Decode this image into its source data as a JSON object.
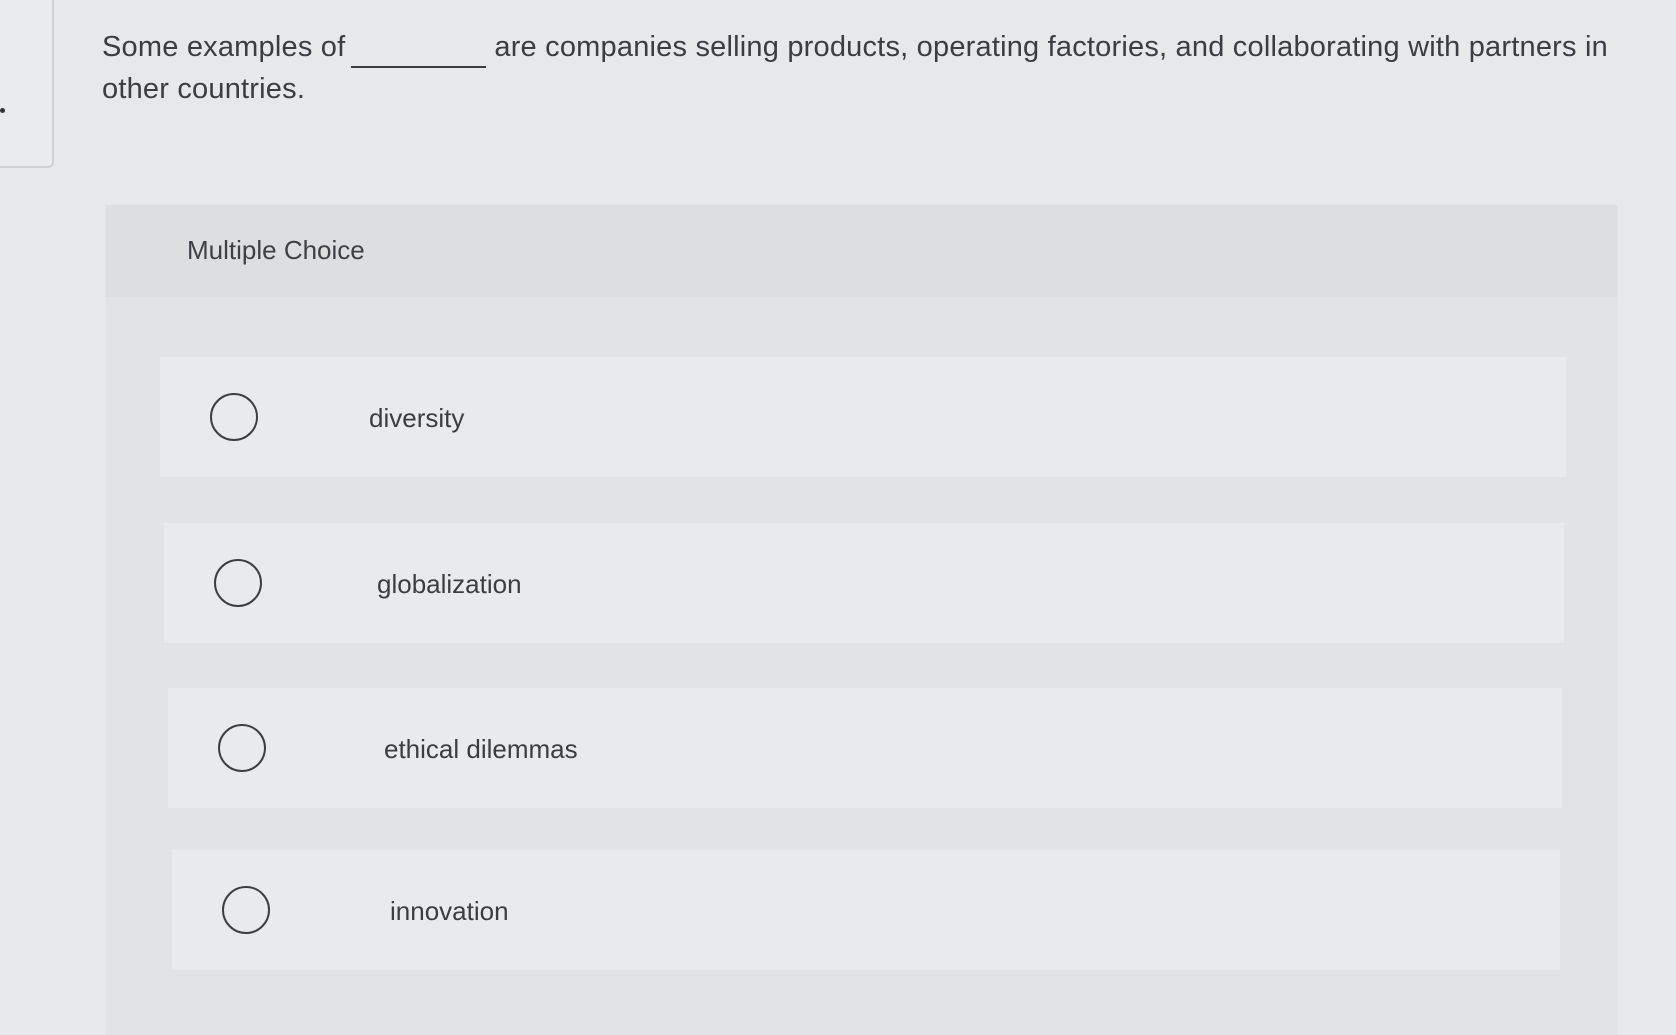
{
  "question": {
    "prefix": "Some examples of",
    "suffix": "are companies selling products, operating factories, and collaborating with partners in other countries."
  },
  "panel": {
    "title": "Multiple Choice"
  },
  "choices": [
    {
      "label": "diversity"
    },
    {
      "label": "globalization"
    },
    {
      "label": "ethical dilemmas"
    },
    {
      "label": "innovation"
    }
  ]
}
